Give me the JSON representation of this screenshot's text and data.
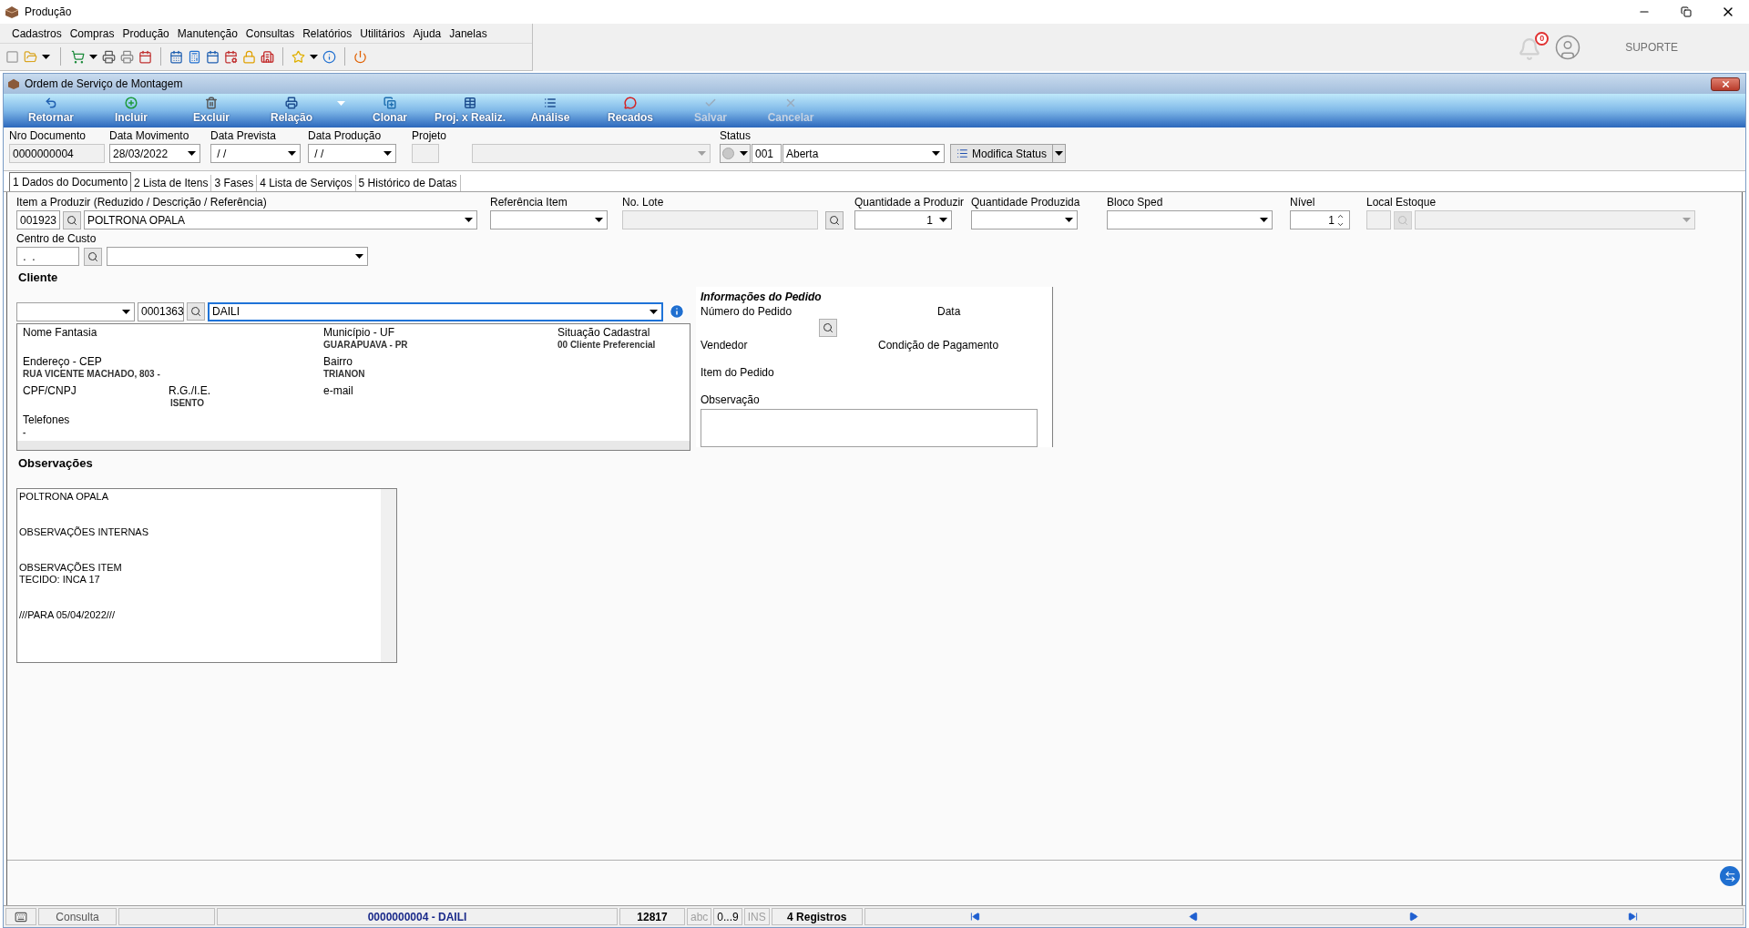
{
  "app": {
    "title": "Produção"
  },
  "menu": [
    "Cadastros",
    "Compras",
    "Produção",
    "Manutenção",
    "Consultas",
    "Relatórios",
    "Utilitários",
    "Ajuda",
    "Janelas"
  ],
  "header": {
    "notification_count": "0",
    "user": "SUPORTE"
  },
  "window": {
    "title": "Ordem de Serviço de Montagem"
  },
  "actions": [
    {
      "kind": "return",
      "label": "Retornar",
      "disabled": false,
      "has_menu": false
    },
    {
      "kind": "add",
      "label": "Incluir",
      "disabled": false,
      "has_menu": false
    },
    {
      "kind": "delete",
      "label": "Excluir",
      "disabled": false,
      "has_menu": false
    },
    {
      "kind": "print",
      "label": "Relação",
      "disabled": false,
      "has_menu": true
    },
    {
      "kind": "clone",
      "label": "Clonar",
      "disabled": false,
      "has_menu": false
    },
    {
      "kind": "table",
      "label": "Proj. x Realiz.",
      "disabled": false,
      "has_menu": false
    },
    {
      "kind": "list",
      "label": "Análise",
      "disabled": false,
      "has_menu": false
    },
    {
      "kind": "message",
      "label": "Recados",
      "disabled": false,
      "has_menu": false
    },
    {
      "kind": "save",
      "label": "Salvar",
      "disabled": true,
      "has_menu": false
    },
    {
      "kind": "cancel",
      "label": "Cancelar",
      "disabled": true,
      "has_menu": false
    }
  ],
  "document_fields": [
    {
      "kind": "text",
      "label": "Nro Documento",
      "value": "0000000004",
      "disabled": true
    },
    {
      "kind": "combo",
      "label": "Data Movimento",
      "value": "28/03/2022",
      "disabled": false
    },
    {
      "kind": "combo",
      "label": "Data Prevista",
      "value": " / /",
      "disabled": false
    },
    {
      "kind": "combo",
      "label": "Data Produção",
      "value": " / /",
      "disabled": false
    },
    {
      "kind": "text",
      "label": "Projeto",
      "disabled": true
    },
    {
      "kind": "combo",
      "disabled": true
    }
  ],
  "status": {
    "label": "Status",
    "code": "001",
    "value": "Aberta"
  },
  "modify_status": {
    "label": "Modifica Status"
  },
  "tabs": [
    {
      "label": "1 Dados do Documento",
      "selected": true
    },
    {
      "label": "2 Lista de Itens",
      "selected": false
    },
    {
      "label": "3 Fases",
      "selected": false
    },
    {
      "label": "4 Lista de Serviços",
      "selected": false
    },
    {
      "label": "5 Histórico de Datas",
      "selected": false
    }
  ],
  "item_fields": [
    {
      "kind": "lookup",
      "label": "Item a Produzir (Reduzido / Descrição / Referência)",
      "code": "001923",
      "value": "POLTRONA OPALA",
      "disabled": false
    },
    {
      "kind": "combo",
      "label": "Referência Item",
      "disabled": false
    },
    {
      "kind": "search",
      "label": "No. Lote",
      "disabled": true
    },
    {
      "kind": "qty",
      "label": "Quantidade a Produzir",
      "value": "1",
      "disabled": false
    },
    {
      "kind": "qty",
      "label": "Quantidade Produzida",
      "disabled": false
    },
    {
      "kind": "combo",
      "label": "Bloco Sped",
      "disabled": false
    },
    {
      "kind": "spin",
      "label": "Nível",
      "value": "1",
      "disabled": false
    },
    {
      "kind": "lookup",
      "label": "Local Estoque",
      "disabled": true
    }
  ],
  "cost_center": {
    "label": "Centro de Custo",
    "code": " .  ."
  },
  "client": {
    "heading": "Cliente",
    "code": "0001363",
    "name": "DAILI",
    "focused": true,
    "fields": [
      {
        "label": "Nome Fantasia"
      },
      {
        "label": "Município - UF",
        "value": "GUARAPUAVA - PR"
      },
      {
        "label": "Situação Cadastral",
        "value": "00 Cliente Preferencial"
      },
      {
        "label": "Endereço - CEP",
        "value": "RUA VICENTE MACHADO, 803 -"
      },
      {
        "label": "Bairro",
        "value": "TRIANON"
      },
      {
        "label": "CPF/CNPJ"
      },
      {
        "label": "R.G./I.E.",
        "value": "ISENTO"
      },
      {
        "label": "e-mail"
      },
      {
        "label": "Telefones",
        "value": "-"
      }
    ]
  },
  "order_info": {
    "title": "Informações do Pedido",
    "number_label": "Número do Pedido",
    "date_label": "Data",
    "seller_label": "Vendedor",
    "payment_label": "Condição de Pagamento",
    "item_label": "Item do Pedido",
    "note_label": "Observação"
  },
  "notes": {
    "heading": "Observações",
    "text": "POLTRONA OPALA\n\n\nOBSERVAÇÕES INTERNAS\n\n\nOBSERVAÇÕES ITEM\nTECIDO: INCA 17\n\n\n///PARA 05/04/2022///"
  },
  "status_bar": {
    "mode": "Consulta",
    "record": "0000000004 - DAILI",
    "number": "12817",
    "indicators": [
      {
        "label": "abc",
        "on": false
      },
      {
        "label": "0...9",
        "on": true
      },
      {
        "label": "INS",
        "on": false
      }
    ],
    "count": "4 Registros"
  }
}
